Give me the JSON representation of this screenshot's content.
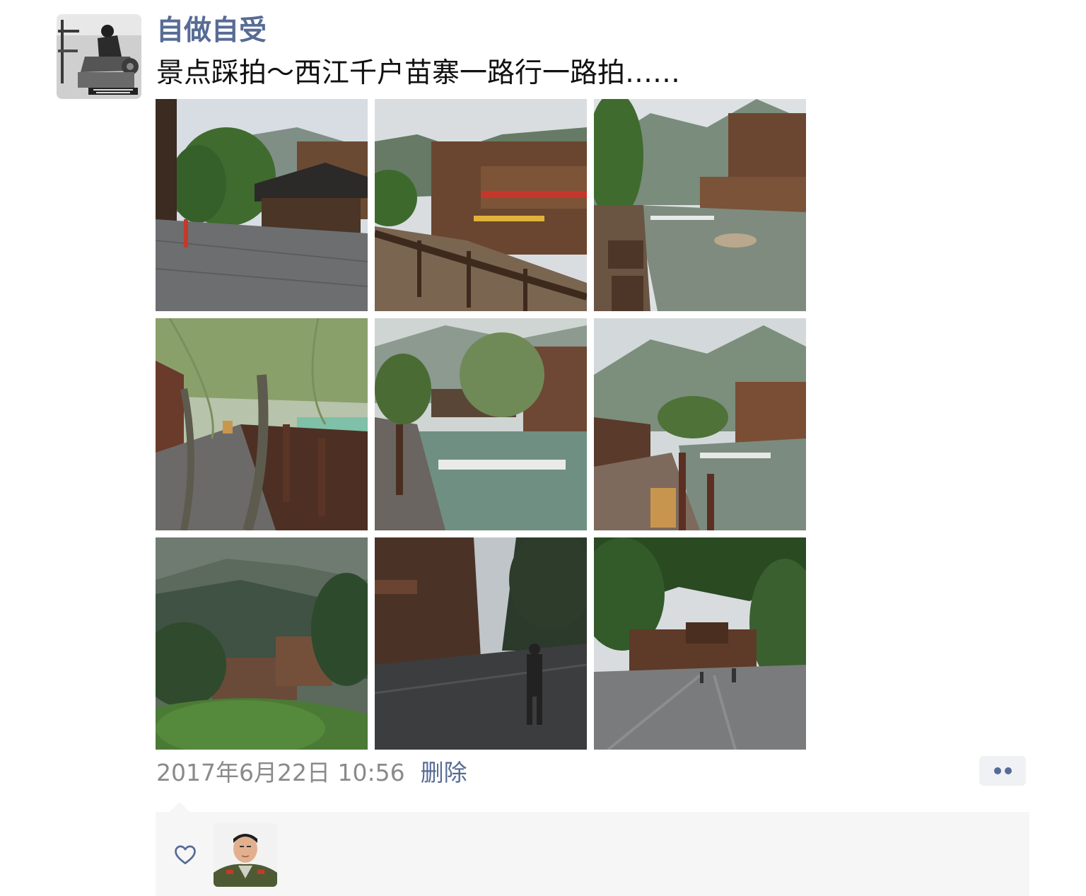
{
  "post": {
    "username": "自做自受",
    "text": "景点踩拍～西江千户苗寨一路行一路拍……",
    "timestamp": "2017年6月22日 10:56",
    "delete_label": "删除"
  },
  "photos": [
    {
      "name": "photo-street-pavilion"
    },
    {
      "name": "photo-wooden-houses-boardwalk"
    },
    {
      "name": "photo-river-village"
    },
    {
      "name": "photo-willow-walkway"
    },
    {
      "name": "photo-bridge-waterfall"
    },
    {
      "name": "photo-boardwalk-river"
    },
    {
      "name": "photo-misty-mountain-village"
    },
    {
      "name": "photo-street-walker"
    },
    {
      "name": "photo-street-trees"
    }
  ],
  "likes": {
    "icon": "heart-icon",
    "count": 1
  },
  "icons": {
    "more": "more-dots-icon",
    "like": "heart-icon"
  },
  "colors": {
    "link": "#576b95",
    "timestamp": "#8a8a8a",
    "panel_bg": "#f6f6f7"
  }
}
